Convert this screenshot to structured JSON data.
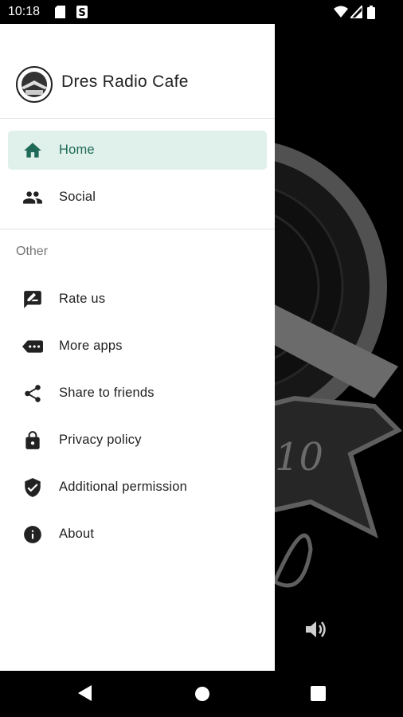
{
  "status_bar": {
    "time": "10:18",
    "icons": [
      "sd-card-icon",
      "sync-icon",
      "wifi-icon",
      "signal-icon",
      "battery-icon"
    ]
  },
  "drawer": {
    "app_name": "Dres Radio Cafe",
    "logo": "radio-cafe-logo",
    "primary_items": [
      {
        "label": "Home",
        "icon": "home-icon",
        "active": true
      },
      {
        "label": "Social",
        "icon": "people-icon",
        "active": false
      }
    ],
    "section_title": "Other",
    "secondary_items": [
      {
        "label": "Rate us",
        "icon": "rate-icon"
      },
      {
        "label": "More apps",
        "icon": "more-apps-icon"
      },
      {
        "label": "Share to friends",
        "icon": "share-icon"
      },
      {
        "label": "Privacy policy",
        "icon": "lock-icon"
      },
      {
        "label": "Additional permission",
        "icon": "shield-icon"
      },
      {
        "label": "About",
        "icon": "info-icon"
      }
    ]
  },
  "background_app": {
    "volume_icon": "volume-icon"
  },
  "nav_bar": {
    "buttons": [
      "back-icon",
      "home-circle-icon",
      "recents-icon"
    ]
  },
  "colors": {
    "accent": "#1f6b58",
    "active_bg": "#e0f0ea",
    "text": "#222222",
    "muted": "#757575"
  }
}
